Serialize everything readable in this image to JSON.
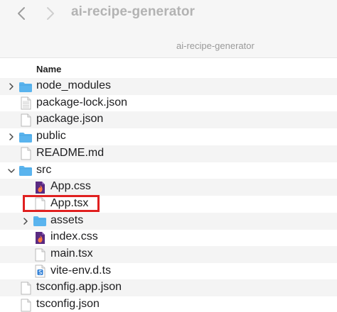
{
  "window": {
    "title": "ai-recipe-generator",
    "path_label": "ai-recipe-generator"
  },
  "columns": {
    "name": "Name"
  },
  "rows": [
    {
      "name": "node_modules",
      "kind": "folder",
      "level": 0,
      "expandable": true,
      "expanded": false
    },
    {
      "name": "package-lock.json",
      "kind": "doc-lines",
      "level": 0,
      "expandable": false
    },
    {
      "name": "package.json",
      "kind": "doc",
      "level": 0,
      "expandable": false
    },
    {
      "name": "public",
      "kind": "folder",
      "level": 0,
      "expandable": true,
      "expanded": false
    },
    {
      "name": "README.md",
      "kind": "doc",
      "level": 0,
      "expandable": false
    },
    {
      "name": "src",
      "kind": "folder",
      "level": 0,
      "expandable": true,
      "expanded": true
    },
    {
      "name": "App.css",
      "kind": "css-icon",
      "level": 1,
      "expandable": false
    },
    {
      "name": "App.tsx",
      "kind": "doc",
      "level": 1,
      "expandable": false,
      "highlighted": true
    },
    {
      "name": "assets",
      "kind": "folder",
      "level": 1,
      "expandable": true,
      "expanded": false
    },
    {
      "name": "index.css",
      "kind": "css-icon",
      "level": 1,
      "expandable": false
    },
    {
      "name": "main.tsx",
      "kind": "doc",
      "level": 1,
      "expandable": false
    },
    {
      "name": "vite-env.d.ts",
      "kind": "ts-icon",
      "level": 1,
      "expandable": false
    },
    {
      "name": "tsconfig.app.json",
      "kind": "doc",
      "level": 0,
      "expandable": false
    },
    {
      "name": "tsconfig.json",
      "kind": "doc",
      "level": 0,
      "expandable": false
    }
  ],
  "colors": {
    "folder": "#5ab4ee",
    "folder_tab": "#4aa6e3",
    "highlight": "#e02020",
    "css_icon": "#5a2a82",
    "css_flame": "#ff7a3c",
    "ts_badge": "#2f7fd6"
  },
  "icons": {
    "back": "chevron-left-icon",
    "forward": "chevron-right-icon",
    "folder": "folder-icon",
    "doc": "document-icon",
    "collapsed": "chevron-right-icon",
    "expanded": "chevron-down-icon"
  }
}
